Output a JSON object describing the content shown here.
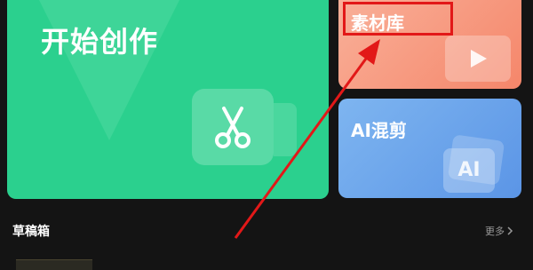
{
  "cards": {
    "start": {
      "title": "开始创作",
      "color": "#2bd08e",
      "icon": "scissors-icon"
    },
    "material": {
      "title": "素材库",
      "color": "#f5866a",
      "icon": "play-icon"
    },
    "ai": {
      "title": "AI混剪",
      "color": "#5b95e6",
      "icon_text": "AI"
    }
  },
  "annotation": {
    "color": "#e21818"
  },
  "drafts": {
    "title": "草稿箱",
    "more": "更多"
  }
}
